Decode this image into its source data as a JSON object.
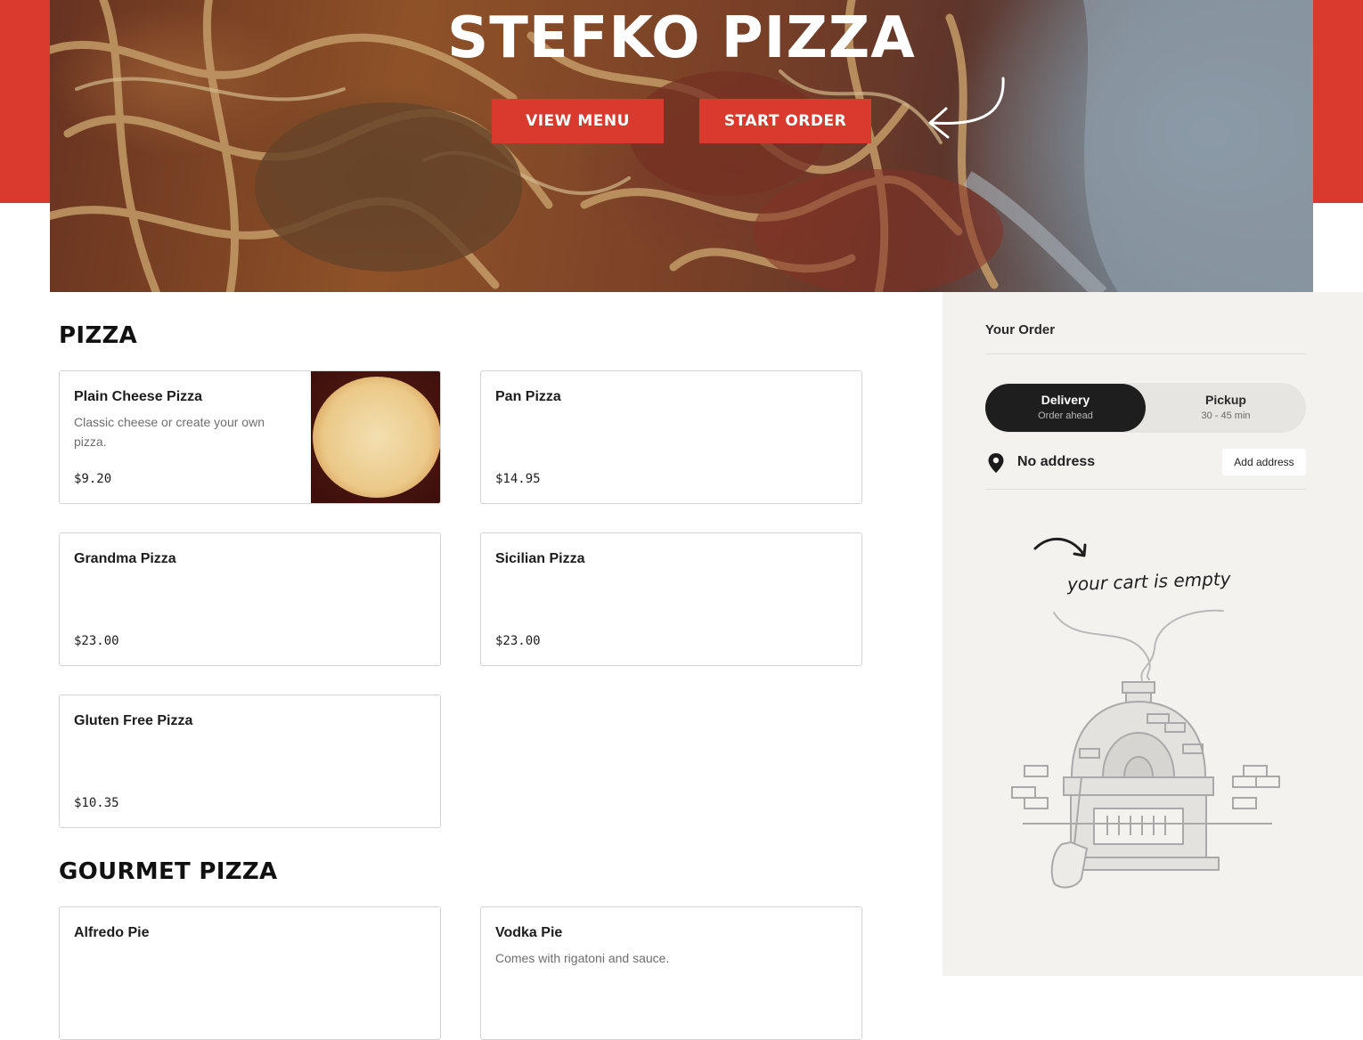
{
  "hero": {
    "title": "STEFKO PIZZA",
    "view_menu_label": "VIEW MENU",
    "start_order_label": "START ORDER"
  },
  "sections": [
    {
      "title": "PIZZA",
      "items": [
        {
          "name": "Plain Cheese Pizza",
          "description": "Classic cheese or create your own pizza.",
          "price": "$9.20"
        },
        {
          "name": "Pan Pizza",
          "description": "",
          "price": "$14.95"
        },
        {
          "name": "Grandma Pizza",
          "description": "",
          "price": "$23.00"
        },
        {
          "name": "Sicilian Pizza",
          "description": "",
          "price": "$23.00"
        },
        {
          "name": "Gluten Free Pizza",
          "description": "",
          "price": "$10.35"
        }
      ]
    },
    {
      "title": "GOURMET PIZZA",
      "items": [
        {
          "name": "Alfredo Pie",
          "description": ""
        },
        {
          "name": "Vodka Pie",
          "description": "Comes with rigatoni and sauce."
        }
      ]
    }
  ],
  "order_panel": {
    "title": "Your Order",
    "delivery": {
      "label": "Delivery",
      "sub": "Order ahead"
    },
    "pickup": {
      "label": "Pickup",
      "sub": "30 - 45 min"
    },
    "address_text": "No address",
    "add_address_label": "Add address",
    "empty_cart_text": "your cart is empty"
  },
  "colors": {
    "brand_red": "#d93a2d",
    "sidebar_bg": "#f3f2ef",
    "toggle_active": "#1e1e1e"
  }
}
